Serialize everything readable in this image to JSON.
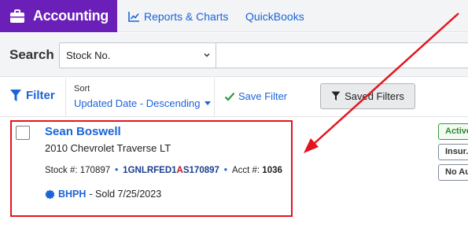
{
  "nav": {
    "app_name": "Accounting",
    "links": [
      {
        "label": "Reports & Charts",
        "icon": "bar-chart-icon"
      },
      {
        "label": "QuickBooks"
      }
    ]
  },
  "search": {
    "label": "Search",
    "field_selected": "Stock No.",
    "input_value": ""
  },
  "filters": {
    "filter_label": "Filter",
    "sort_title": "Sort",
    "sort_value": "Updated Date - Descending",
    "save_filter_label": "Save Filter",
    "saved_filters_label": "Saved Filters"
  },
  "record": {
    "customer": "Sean Boswell",
    "vehicle": "2010 Chevrolet Traverse LT",
    "stock_label": "Stock #:",
    "stock_no": "170897",
    "vin_prefix": "1GNLRFED1",
    "vin_highlight": "A",
    "vin_suffix": "S170897",
    "acct_label": "Acct #:",
    "acct_no": "1036",
    "deal_type": "BHPH",
    "sold_text": "- Sold 7/25/2023",
    "badges": [
      "Active",
      "Insur.",
      "No Au"
    ]
  },
  "colors": {
    "brand": "#6a1fb8",
    "link": "#1a63d8",
    "annotation": "#e4141e",
    "active_badge": "#2a8a2a"
  }
}
